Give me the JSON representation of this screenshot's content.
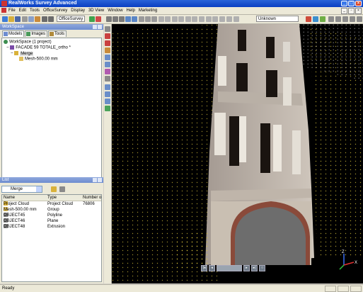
{
  "app": {
    "title": "RealWorks Survey Advanced"
  },
  "menu": {
    "items": [
      "File",
      "Edit",
      "Tools",
      "OfficeSurvey",
      "Display",
      "3D View",
      "Window",
      "Help",
      "Marketing"
    ]
  },
  "toolbar": {
    "mode_label": "OfficeSurvey",
    "unknown_value": "Unknown"
  },
  "workspace": {
    "panel_title": "WorkSpace",
    "tabs": [
      "Models",
      "Images",
      "Tools"
    ],
    "tree": {
      "root": "WorkSpace (1 project)",
      "project": "FACADE 59 TOTALE_ortho",
      "project_marker": "*",
      "group": "Merge",
      "mesh": "Mesh-500.00 mm"
    }
  },
  "list_panel": {
    "panel_title": "List",
    "combo_value": "Merge",
    "columns": [
      "Name",
      "Type",
      "Number o"
    ],
    "rows": [
      {
        "name": "Project Cloud",
        "type": "Project Cloud",
        "number": "76806"
      },
      {
        "name": "Mesh-500.00 mm",
        "type": "Group",
        "number": ""
      },
      {
        "name": "OBJECT45",
        "type": "Polyline",
        "number": ""
      },
      {
        "name": "OBJECT46",
        "type": "Plane",
        "number": ""
      },
      {
        "name": "OBJECT48",
        "type": "Extrusion",
        "number": ""
      }
    ]
  },
  "axis": {
    "z": "Z",
    "x": "X"
  },
  "status": {
    "text": "Ready"
  },
  "colors": {
    "title_bar": "#0a3ec2",
    "panel_title": "#7b97d6",
    "viewport": "#000000",
    "point_cloud": "#d8c23a"
  }
}
